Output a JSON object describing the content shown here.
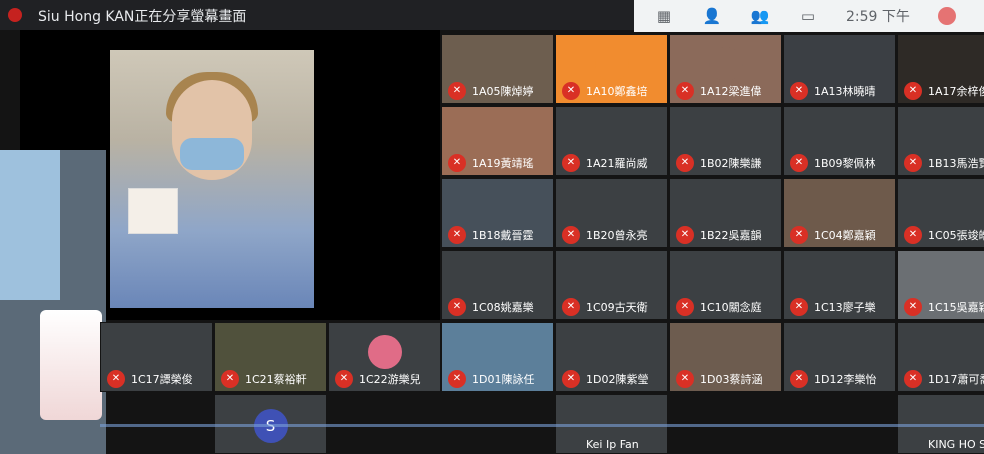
{
  "window": {
    "presenting_text": "Siu Hong KAN正在分享螢幕畫面",
    "clock": "2:59 下午"
  },
  "controls": {
    "icons": [
      "grid-icon",
      "people-icon",
      "chat-icon",
      "activities-icon"
    ]
  },
  "participants": [
    {
      "name": "1A05陳焯婷",
      "color": "#6d5e4f"
    },
    {
      "name": "1A10鄭鑫培",
      "color": "#f18c2f",
      "initial": ""
    },
    {
      "name": "1A12梁進偉",
      "color": "#8b6a5a",
      "initial": ""
    },
    {
      "name": "1A13林曉晴",
      "color": "#3b3f44"
    },
    {
      "name": "1A17余梓俊",
      "color": "#2e2a26"
    },
    {
      "name": "1A19黃靖瑤",
      "color": "#9b6d56"
    },
    {
      "name": "1A21羅尚威",
      "color": "#3c4043"
    },
    {
      "name": "1B02陳樂謙",
      "color": "#3c4043"
    },
    {
      "name": "1B09黎佩林",
      "color": "#3c4043"
    },
    {
      "name": "1B13馬浩賢",
      "color": "#3c4043"
    },
    {
      "name": "1B18戴晉霆",
      "color": "#46505a"
    },
    {
      "name": "1B20曾永亮",
      "color": "#3c4043"
    },
    {
      "name": "1B22吳嘉韻",
      "color": "#3c4043"
    },
    {
      "name": "1C04鄭嘉穎",
      "color": "#6e5a4b"
    },
    {
      "name": "1C05張竣皓",
      "color": "#3c4043"
    },
    {
      "name": "1C08姚嘉樂",
      "color": "#3c4043"
    },
    {
      "name": "1C09古天衛",
      "color": "#3c4043"
    },
    {
      "name": "1C10關念庭",
      "color": "#3c4043"
    },
    {
      "name": "1C13廖子樂",
      "color": "#3c4043"
    },
    {
      "name": "1C15吳嘉穎",
      "color": "#6b6f73"
    },
    {
      "name": "1C17譚榮俊",
      "color": "#3c4043"
    },
    {
      "name": "1C21蔡裕軒",
      "color": "#50513c"
    },
    {
      "name": "1C22游樂兒",
      "color": "#3c4043",
      "initial": "",
      "avatar_color": "#e06c87"
    },
    {
      "name": "1D01陳詠任",
      "color": "#5c7f9a"
    },
    {
      "name": "1D02陳紫瑩",
      "color": "#3c4043"
    },
    {
      "name": "1D03蔡詩涵",
      "color": "#6d5c4f"
    },
    {
      "name": "1D12李樂怡",
      "color": "#3c4043"
    },
    {
      "name": "1D17蕭可喬",
      "color": "#3c4043"
    }
  ],
  "bottom_row": [
    {
      "initial": "S",
      "avatar_color": "#3f51b5"
    },
    {
      "label": "Kei Ip Fan"
    },
    {
      "label": "KING HO S"
    }
  ]
}
